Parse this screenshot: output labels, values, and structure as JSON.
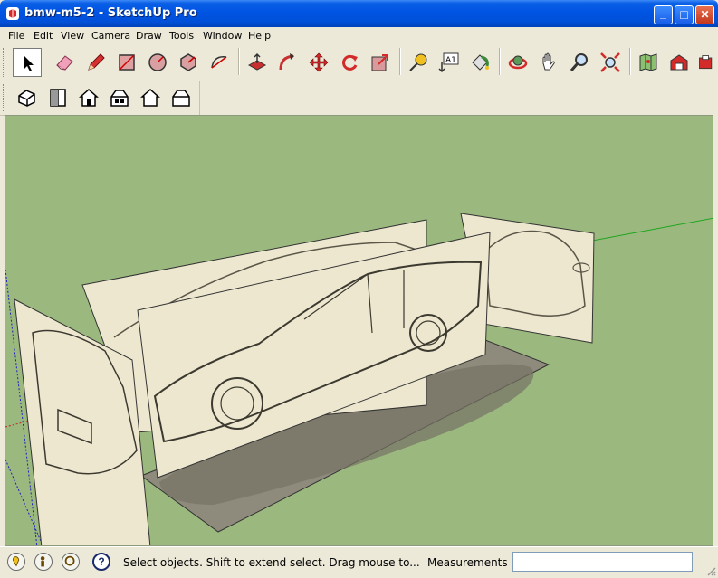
{
  "window": {
    "title": "bmw-m5-2 - SketchUp Pro",
    "minimize_glyph": "_",
    "maximize_glyph": "□",
    "close_glyph": "✕"
  },
  "menu": [
    "File",
    "Edit",
    "View",
    "Camera",
    "Draw",
    "Tools",
    "Window",
    "Help"
  ],
  "toolbar_main": [
    {
      "id": "select",
      "icon": "arrow-cursor-icon",
      "selected": true
    },
    {
      "id": "eraser",
      "icon": "eraser-icon"
    },
    {
      "id": "pencil",
      "icon": "pencil-icon"
    },
    {
      "id": "rectangle",
      "icon": "rectangle-icon"
    },
    {
      "id": "circle",
      "icon": "circle-icon"
    },
    {
      "id": "polygon",
      "icon": "polygon-icon"
    },
    {
      "id": "arc",
      "icon": "arc-icon"
    },
    {
      "id": "push-pull",
      "icon": "push-pull-icon"
    },
    {
      "id": "follow-me",
      "icon": "follow-me-icon"
    },
    {
      "id": "move",
      "icon": "move-icon"
    },
    {
      "id": "rotate",
      "icon": "rotate-icon"
    },
    {
      "id": "scale",
      "icon": "scale-icon"
    },
    {
      "id": "tape-measure",
      "icon": "tape-measure-icon"
    },
    {
      "id": "text",
      "icon": "text-label-icon",
      "label": "A1"
    },
    {
      "id": "paint-bucket",
      "icon": "paint-bucket-icon"
    },
    {
      "id": "orbit",
      "icon": "orbit-icon"
    },
    {
      "id": "pan",
      "icon": "pan-hand-icon"
    },
    {
      "id": "zoom",
      "icon": "zoom-magnifier-icon"
    },
    {
      "id": "zoom-extents",
      "icon": "zoom-extents-icon"
    },
    {
      "id": "map",
      "icon": "map-icon"
    },
    {
      "id": "warehouse",
      "icon": "warehouse-icon"
    },
    {
      "id": "extension",
      "icon": "extension-icon"
    }
  ],
  "toolbar_views": [
    {
      "id": "iso",
      "icon": "iso-view-icon"
    },
    {
      "id": "top",
      "icon": "top-view-icon"
    },
    {
      "id": "front",
      "icon": "front-view-icon"
    },
    {
      "id": "right",
      "icon": "right-view-icon"
    },
    {
      "id": "back",
      "icon": "back-view-icon"
    },
    {
      "id": "left",
      "icon": "left-view-icon"
    }
  ],
  "viewport": {
    "background": "#9bb87f",
    "panel_color": "#ede7cf",
    "shadow_color": "#8e8a7c",
    "axis_green": "#1fa61f",
    "axis_red": "#c02020",
    "axis_blue": "#2020c0"
  },
  "status": {
    "message": "Select objects. Shift to extend select. Drag mouse to...",
    "measurements_label": "Measurements",
    "measurements_value": "",
    "icons": [
      "geo-location-icon",
      "credits-icon",
      "signin-icon",
      "help-icon"
    ],
    "help_glyph": "?"
  }
}
